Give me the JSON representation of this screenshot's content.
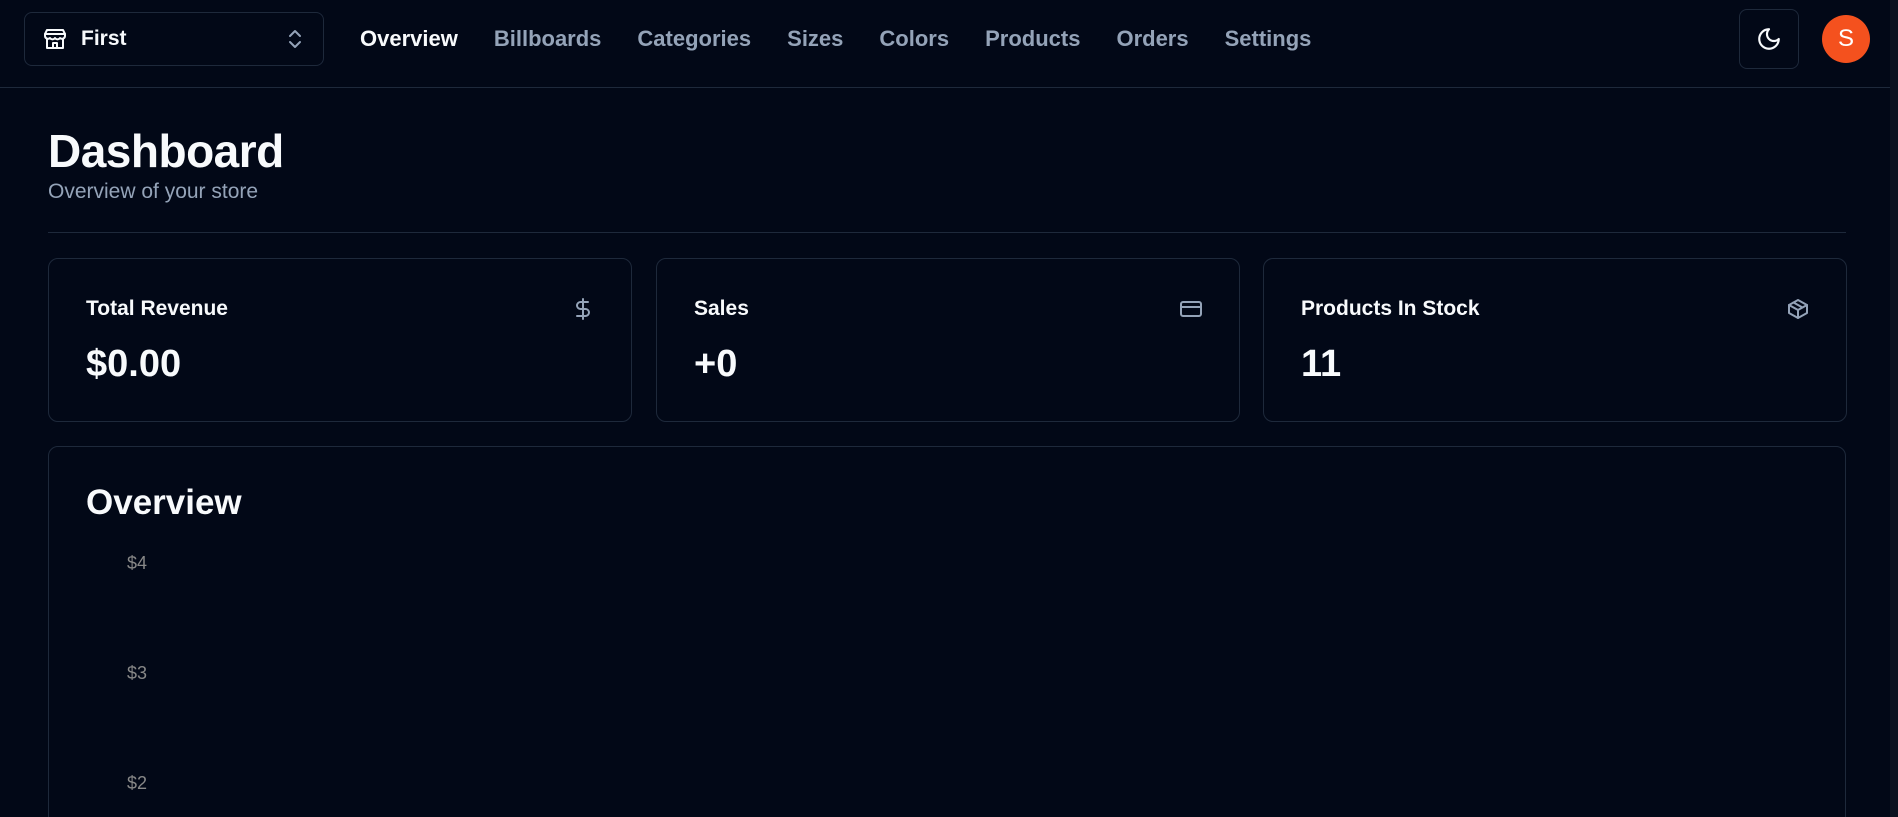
{
  "store_switcher": {
    "name": "First"
  },
  "nav": {
    "items": [
      {
        "label": "Overview",
        "active": true
      },
      {
        "label": "Billboards",
        "active": false
      },
      {
        "label": "Categories",
        "active": false
      },
      {
        "label": "Sizes",
        "active": false
      },
      {
        "label": "Colors",
        "active": false
      },
      {
        "label": "Products",
        "active": false
      },
      {
        "label": "Orders",
        "active": false
      },
      {
        "label": "Settings",
        "active": false
      }
    ]
  },
  "user": {
    "avatar_initial": "S",
    "avatar_color": "#f4511e"
  },
  "header": {
    "title": "Dashboard",
    "subtitle": "Overview of your store"
  },
  "stats": [
    {
      "title": "Total Revenue",
      "value": "$0.00",
      "icon": "dollar-sign-icon"
    },
    {
      "title": "Sales",
      "value": "+0",
      "icon": "credit-card-icon"
    },
    {
      "title": "Products In Stock",
      "value": "11",
      "icon": "package-icon"
    }
  ],
  "overview": {
    "title": "Overview"
  },
  "chart_data": {
    "type": "bar",
    "categories": [],
    "series": [],
    "title": "Overview",
    "ylim": [
      0,
      4
    ],
    "y_ticks": [
      "$4",
      "$3",
      "$2"
    ],
    "grid": false
  },
  "colors": {
    "background": "#020817",
    "border": "#1e293b",
    "muted_text": "#94a3b8",
    "avatar": "#f4511e"
  }
}
